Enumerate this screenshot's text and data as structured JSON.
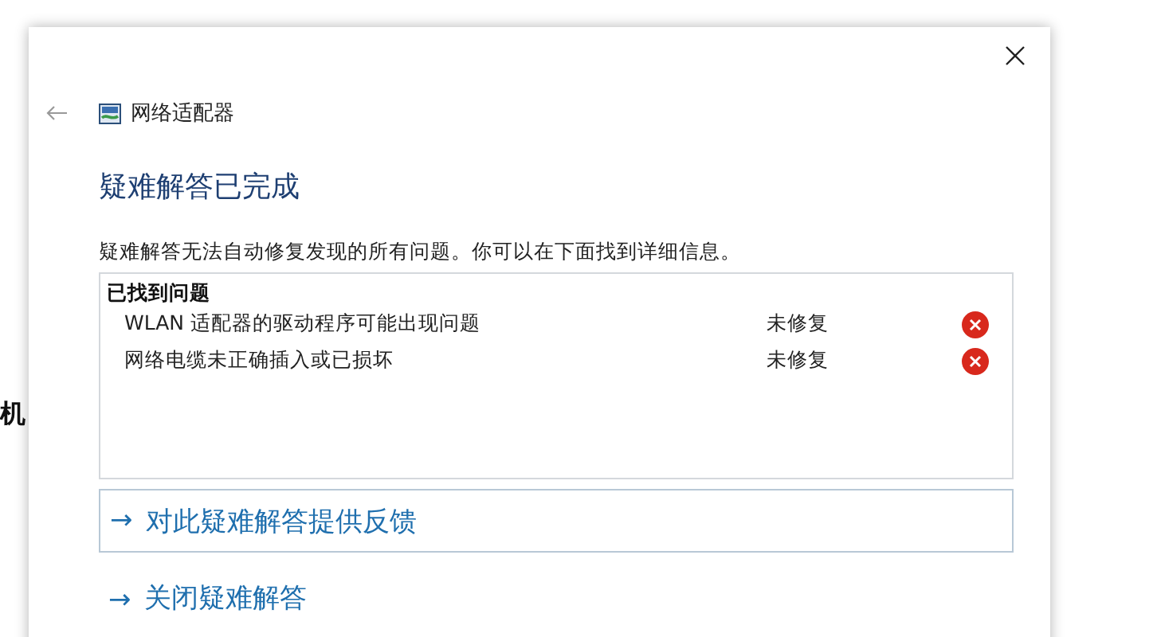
{
  "background_text": "机",
  "window": {
    "title": "网络适配器",
    "heading": "疑难解答已完成",
    "description": "疑难解答无法自动修复发现的所有问题。你可以在下面找到详细信息。"
  },
  "problems": {
    "title": "已找到问题",
    "items": [
      {
        "name": "WLAN 适配器的驱动程序可能出现问题",
        "status": "未修复",
        "fixed": false
      },
      {
        "name": "网络电缆未正确插入或已损坏",
        "status": "未修复",
        "fixed": false
      }
    ]
  },
  "links": [
    {
      "label": "对此疑难解答提供反馈",
      "arrow": "→",
      "boxed": true
    },
    {
      "label": "关闭疑难解答",
      "arrow": "→",
      "boxed": false
    }
  ]
}
